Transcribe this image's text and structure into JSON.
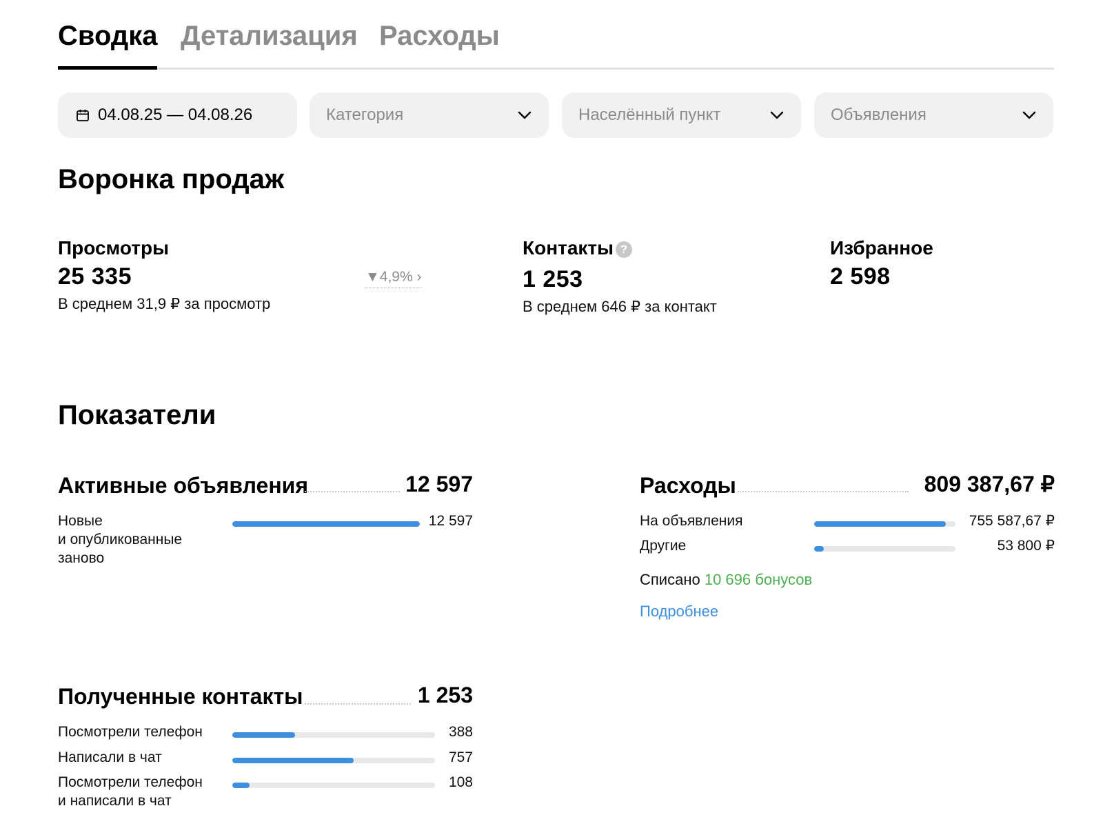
{
  "tabs": [
    {
      "label": "Сводка",
      "active": true
    },
    {
      "label": "Детализация",
      "active": false
    },
    {
      "label": "Расходы",
      "active": false
    }
  ],
  "filters": {
    "date_range": "04.08.25 — 04.08.26",
    "category_placeholder": "Категория",
    "locality_placeholder": "Населённый пункт",
    "ads_placeholder": "Объявления"
  },
  "funnel": {
    "title": "Воронка продаж",
    "views": {
      "label": "Просмотры",
      "value": "25 335",
      "sub": "В среднем 31,9 ₽ за просмотр",
      "trend": "4,9%"
    },
    "contacts": {
      "label": "Контакты",
      "value": "1 253",
      "sub": "В среднем 646 ₽ за контакт",
      "help": "?"
    },
    "favorites": {
      "label": "Избранное",
      "value": "2 598"
    }
  },
  "indicators": {
    "title": "Показатели",
    "active_ads": {
      "title": "Активные объявления",
      "total": "12 597",
      "rows": [
        {
          "label_line1": "Новые",
          "label_line2": "и опубликованные",
          "label_line3": "заново",
          "value": "12 597",
          "fraction": 1.0
        }
      ]
    },
    "expenses": {
      "title": "Расходы",
      "total": "809 387,67 ₽",
      "rows": [
        {
          "label": "На объявления",
          "value": "755 587,67 ₽",
          "fraction": 0.93
        },
        {
          "label": "Другие",
          "value": "53 800 ₽",
          "fraction": 0.066
        }
      ],
      "bonus_prefix": "Списано",
      "bonus_amount": "10 696 бонусов",
      "more_link": "Подробнее"
    },
    "contacts_received": {
      "title": "Полученные контакты",
      "total": "1 253",
      "rows": [
        {
          "label_line1": "Посмотрели телефон",
          "value": "388",
          "fraction": 0.31
        },
        {
          "label_line1": "Написали в чат",
          "value": "757",
          "fraction": 0.6
        },
        {
          "label_line1": "Посмотрели телефон",
          "label_line2": "и написали в чат",
          "value": "108",
          "fraction": 0.086
        }
      ]
    }
  },
  "colors": {
    "accent": "#3d8fe0",
    "bonus": "#4caf50",
    "muted": "#8b8b8b"
  }
}
